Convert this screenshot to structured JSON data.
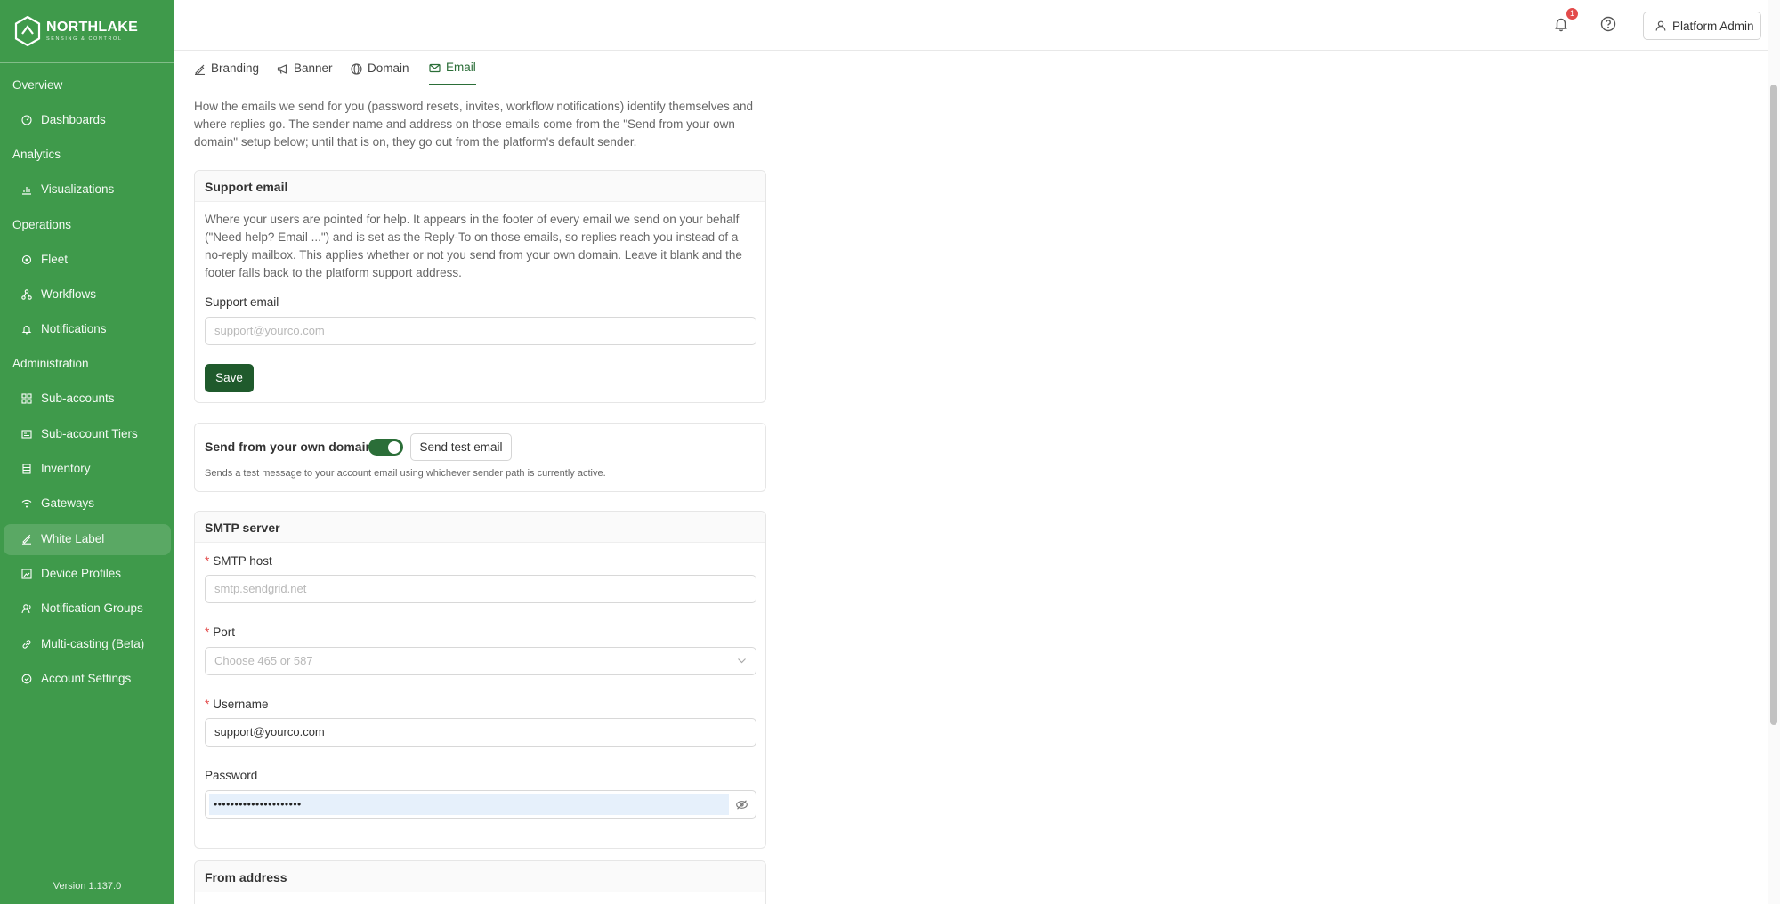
{
  "brand": {
    "name": "NORTHLAKE",
    "tagline": "SENSING & CONTROL"
  },
  "sidebar": {
    "sections": [
      {
        "label": "Overview",
        "items": [
          {
            "label": "Dashboards",
            "icon": "dashboard-icon"
          }
        ]
      },
      {
        "label": "Analytics",
        "items": [
          {
            "label": "Visualizations",
            "icon": "chart-icon"
          }
        ]
      },
      {
        "label": "Operations",
        "items": [
          {
            "label": "Fleet",
            "icon": "fleet-icon"
          },
          {
            "label": "Workflows",
            "icon": "workflow-icon"
          },
          {
            "label": "Notifications",
            "icon": "bell-icon"
          }
        ]
      },
      {
        "label": "Administration",
        "items": [
          {
            "label": "Sub-accounts",
            "icon": "grid-icon"
          },
          {
            "label": "Sub-account Tiers",
            "icon": "tiers-icon"
          },
          {
            "label": "Inventory",
            "icon": "inventory-icon"
          },
          {
            "label": "Gateways",
            "icon": "wifi-icon"
          },
          {
            "label": "White Label",
            "icon": "brush-icon",
            "active": true
          },
          {
            "label": "Device Profiles",
            "icon": "profile-icon"
          },
          {
            "label": "Notification Groups",
            "icon": "group-icon"
          },
          {
            "label": "Multi-casting (Beta)",
            "icon": "link-icon"
          },
          {
            "label": "Account Settings",
            "icon": "settings-icon"
          }
        ]
      }
    ],
    "version": "Version 1.137.0"
  },
  "topbar": {
    "notification_count": "1",
    "user_label": "Platform Admin"
  },
  "tabs": [
    {
      "label": "Branding",
      "icon": "brush-icon"
    },
    {
      "label": "Banner",
      "icon": "megaphone-icon"
    },
    {
      "label": "Domain",
      "icon": "globe-icon"
    },
    {
      "label": "Email",
      "icon": "mail-icon",
      "active": true
    }
  ],
  "intro": "How the emails we send for you (password resets, invites, workflow notifications) identify themselves and where replies go. The sender name and address on those emails come from the \"Send from your own domain\" setup below; until that is on, they go out from the platform's default sender.",
  "support_card": {
    "title": "Support email",
    "description": "Where your users are pointed for help. It appears in the footer of every email we send on your behalf (\"Need help? Email ...\") and is set as the Reply-To on those emails, so replies reach you instead of a no-reply mailbox. This applies whether or not you send from your own domain. Leave it blank and the footer falls back to the platform support address.",
    "field_label": "Support email",
    "placeholder": "support@yourco.com",
    "save_label": "Save"
  },
  "domain_card": {
    "title": "Send from your own domain",
    "toggle_on": true,
    "test_button": "Send test email",
    "hint": "Sends a test message to your account email using whichever sender path is currently active."
  },
  "smtp_card": {
    "title": "SMTP server",
    "host_label": "SMTP host",
    "host_placeholder": "smtp.sendgrid.net",
    "port_label": "Port",
    "port_placeholder": "Choose 465 or 587",
    "username_label": "Username",
    "username_value": "support@yourco.com",
    "password_label": "Password",
    "password_value": "•••••••••••••••••••••"
  },
  "from_card": {
    "title": "From address"
  },
  "colors": {
    "sidebar": "#3f9a4b",
    "primary": "#1f5a2c",
    "active_tab": "#2b6e38",
    "badge": "#e34b4b"
  }
}
